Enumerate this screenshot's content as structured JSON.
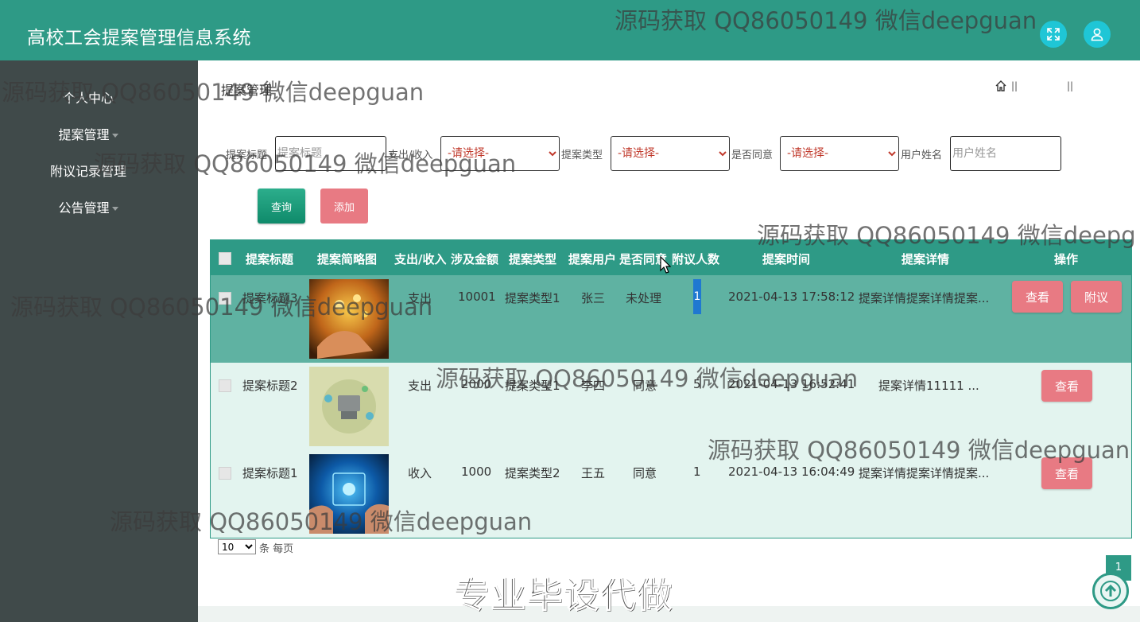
{
  "app": {
    "title": "高校工会提案管理信息系统"
  },
  "sidebar": {
    "items": [
      {
        "label": "个人中心",
        "has_caret": false
      },
      {
        "label": "提案管理",
        "has_caret": true
      },
      {
        "label": "附议记录管理",
        "has_caret": false
      },
      {
        "label": "公告管理",
        "has_caret": true
      }
    ]
  },
  "breadcrumb": {
    "title": "提案管理",
    "sep1": "||",
    "sep2": "||"
  },
  "search": {
    "title_label": "提案标题",
    "title_placeholder": "提案标题",
    "type_io_label": "支出/收入",
    "type_io_selected": "-请选择-",
    "category_label": "提案类型",
    "category_selected": "-请选择-",
    "agree_label": "是否同意",
    "agree_selected": "-请选择-",
    "user_label": "用户姓名",
    "user_placeholder": "用户姓名",
    "query_button": "查询",
    "add_button": "添加"
  },
  "table": {
    "headers": [
      "提案标题",
      "提案简略图",
      "支出/收入",
      "涉及金额",
      "提案类型",
      "提案用户",
      "是否同意",
      "附议人数",
      "提案时间",
      "提案详情",
      "操作"
    ],
    "rows": [
      {
        "title": "提案标题3",
        "io": "支出",
        "amount": "10001",
        "type": "提案类型1",
        "user": "张三",
        "agree": "未处理",
        "count": "1",
        "time": "2021-04-13 17:58:12",
        "detail": "提案详情提案详情提案...",
        "actions": [
          "查看",
          "附议"
        ]
      },
      {
        "title": "提案标题2",
        "io": "支出",
        "amount": "2000",
        "type": "提案类型1",
        "user": "李四",
        "agree": "同意",
        "count": "5",
        "time": "2021-04-13 16:52:41",
        "detail": "提案详情11111 ...",
        "actions": [
          "查看"
        ]
      },
      {
        "title": "提案标题1",
        "io": "收入",
        "amount": "1000",
        "type": "提案类型2",
        "user": "王五",
        "agree": "同意",
        "count": "1",
        "time": "2021-04-13 16:04:49",
        "detail": "提案详情提案详情提案...",
        "actions": [
          "查看"
        ]
      }
    ]
  },
  "pagination": {
    "page_size": "10",
    "page_size_label": "条 每页",
    "current_page": "1"
  },
  "watermarks": {
    "text": "源码获取 QQ86050149 微信deepguan",
    "text_cut": "源码获取 QQ86050149 微信deepg",
    "promo": "专业毕设代做"
  },
  "colors": {
    "primary": "#2e9a86",
    "sidebar": "#404a4a",
    "danger": "#e87a83",
    "icon_button": "#1fc6d6"
  },
  "icons": {
    "fullscreen": "expand-icon",
    "user": "user-icon",
    "home": "home-icon",
    "back_to_top": "arrow-up-icon"
  }
}
